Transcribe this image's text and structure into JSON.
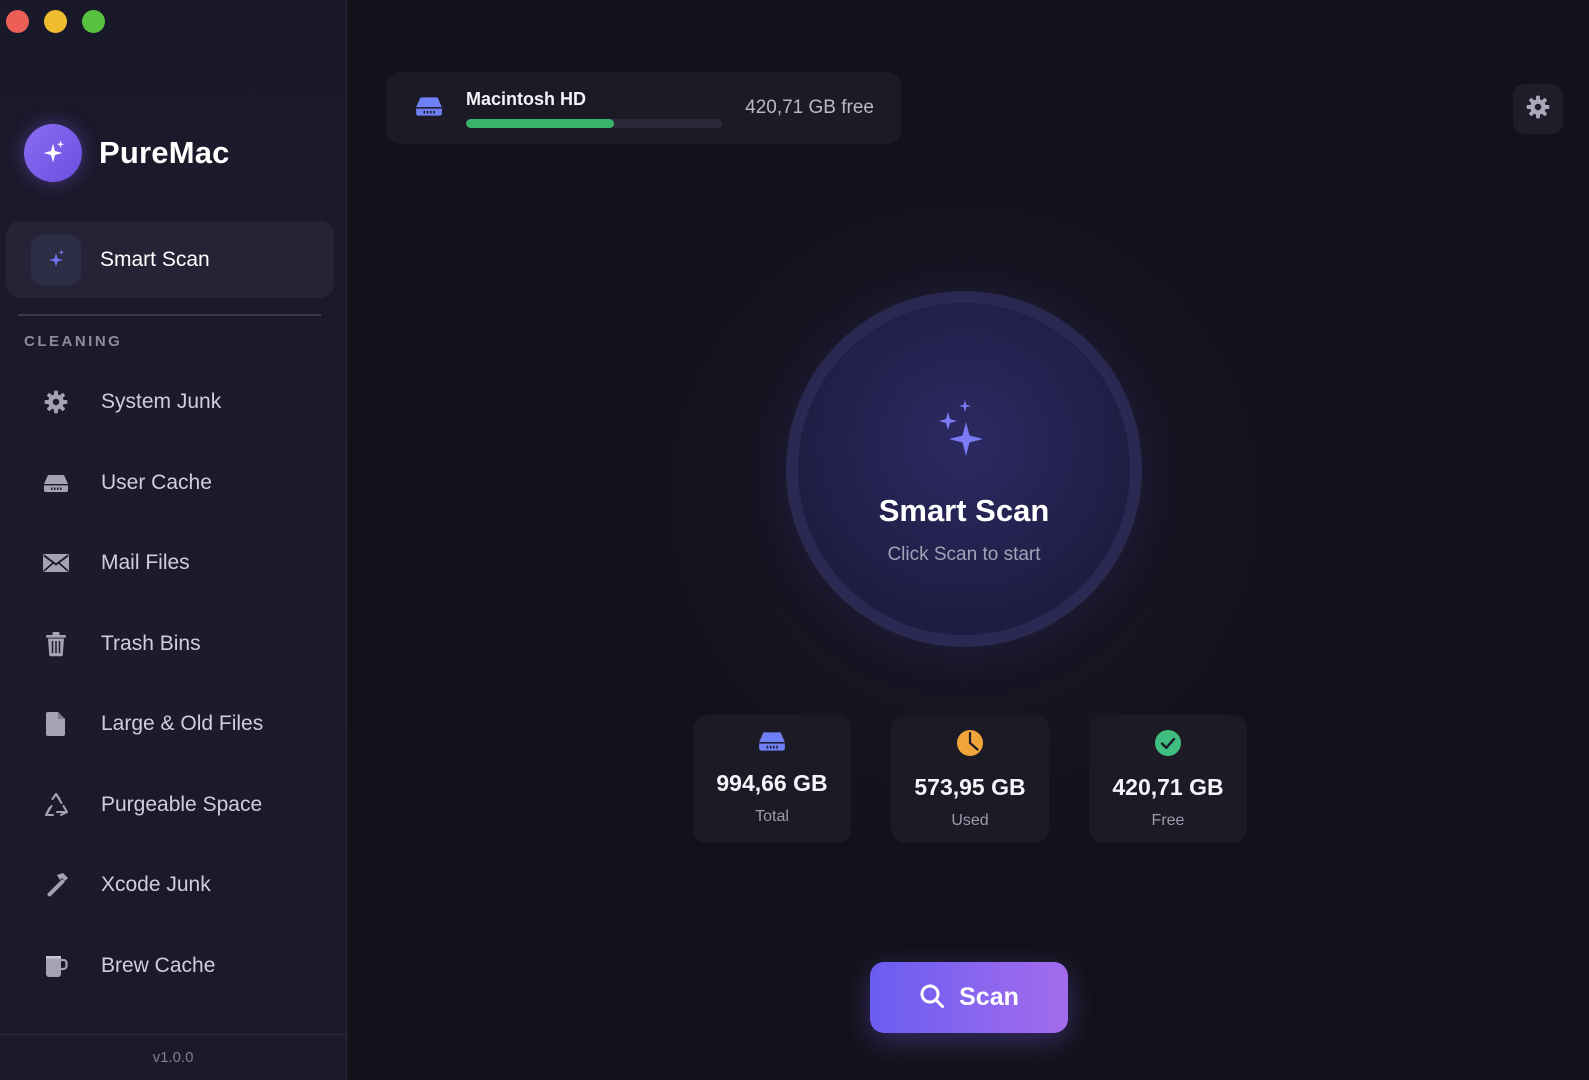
{
  "window": {
    "controls": [
      "close",
      "minimize",
      "maximize"
    ]
  },
  "app": {
    "name": "PureMac",
    "version": "v1.0.0",
    "accent_color": "#7b5cf0"
  },
  "sidebar": {
    "active_item": {
      "label": "Smart Scan",
      "icon": "sparkles-icon"
    },
    "section_title": "CLEANING",
    "items": [
      {
        "label": "System Junk",
        "icon": "gear-icon"
      },
      {
        "label": "User Cache",
        "icon": "drive-icon"
      },
      {
        "label": "Mail Files",
        "icon": "envelope-icon"
      },
      {
        "label": "Trash Bins",
        "icon": "trash-icon"
      },
      {
        "label": "Large & Old Files",
        "icon": "document-icon"
      },
      {
        "label": "Purgeable Space",
        "icon": "recycle-icon"
      },
      {
        "label": "Xcode Junk",
        "icon": "hammer-icon"
      },
      {
        "label": "Brew Cache",
        "icon": "cup-icon"
      }
    ]
  },
  "disk": {
    "name": "Macintosh HD",
    "free_text": "420,71 GB free",
    "used_fraction": 0.577,
    "bar_color": "#37b36c"
  },
  "scan_panel": {
    "title": "Smart Scan",
    "subtitle": "Click Scan to start"
  },
  "stats": [
    {
      "value": "994,66 GB",
      "label": "Total",
      "icon": "drive-icon",
      "color": "#6f7ff5"
    },
    {
      "value": "573,95 GB",
      "label": "Used",
      "icon": "pie-chart-icon",
      "color": "#f0a43a"
    },
    {
      "value": "420,71 GB",
      "label": "Free",
      "icon": "checkmark-circle-icon",
      "color": "#3fbf7f"
    }
  ],
  "scan_button": {
    "label": "Scan",
    "icon": "search-icon"
  }
}
